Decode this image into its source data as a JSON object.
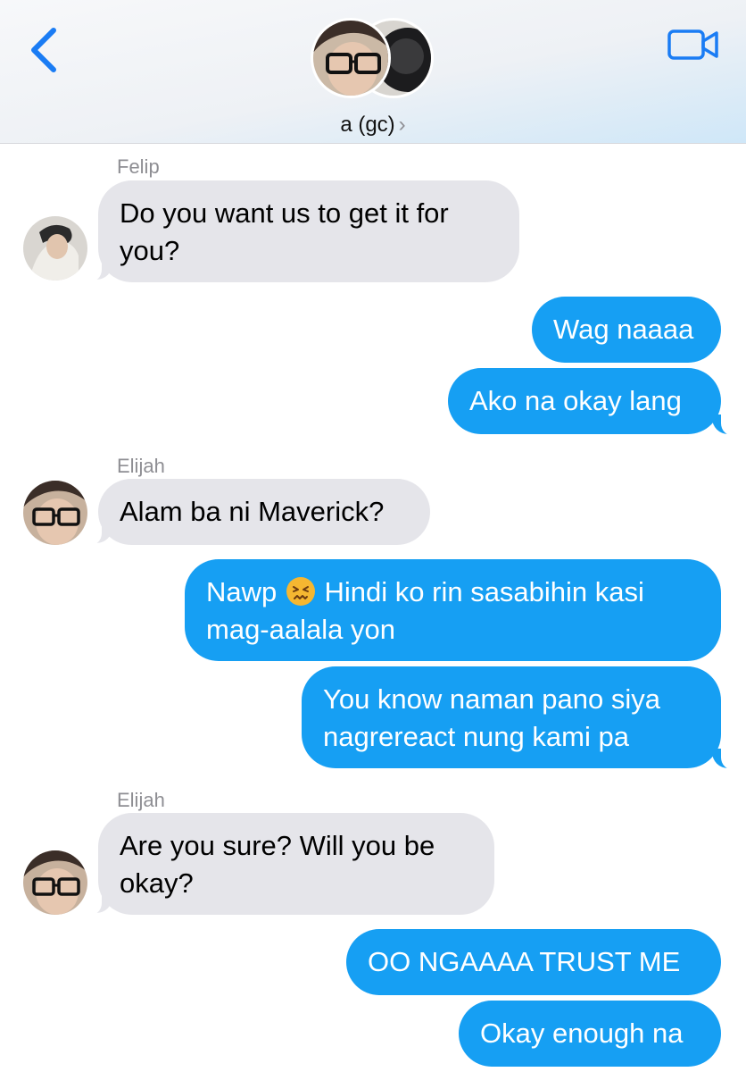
{
  "header": {
    "title": "a (gc)",
    "chevron": "›",
    "back_icon": "chevron-left-icon",
    "video_icon": "video-camera-icon",
    "accent_color": "#1a7cf4"
  },
  "messages": [
    {
      "sender": "Felip",
      "text": "Do you want us to get it for you?",
      "line1": "Do you want us to get it for",
      "line2": "you?",
      "direction": "in"
    },
    {
      "text": "Wag naaaa",
      "direction": "out"
    },
    {
      "text": "Ako na okay lang",
      "direction": "out"
    },
    {
      "sender": "Elijah",
      "text": "Alam ba ni Maverick?",
      "direction": "in"
    },
    {
      "line1_a": "Nawp",
      "emoji": "confounded-face-emoji",
      "line1_b": "Hindi ko rin sasabihin kasi",
      "line2": "mag-aalala yon",
      "direction": "out"
    },
    {
      "line1": "You know naman pano siya",
      "line2": "nagrereact nung kami pa",
      "direction": "out"
    },
    {
      "sender": "Elijah",
      "line1": "Are you sure? Will you be",
      "line2": "okay?",
      "direction": "in"
    },
    {
      "text": "OO NGAAAA TRUST ME",
      "direction": "out"
    },
    {
      "text": "Okay enough na",
      "direction": "out"
    }
  ],
  "colors": {
    "incoming_bubble": "#e5e5ea",
    "outgoing_bubble": "#169ff3",
    "sender_label": "#8e8e93"
  }
}
